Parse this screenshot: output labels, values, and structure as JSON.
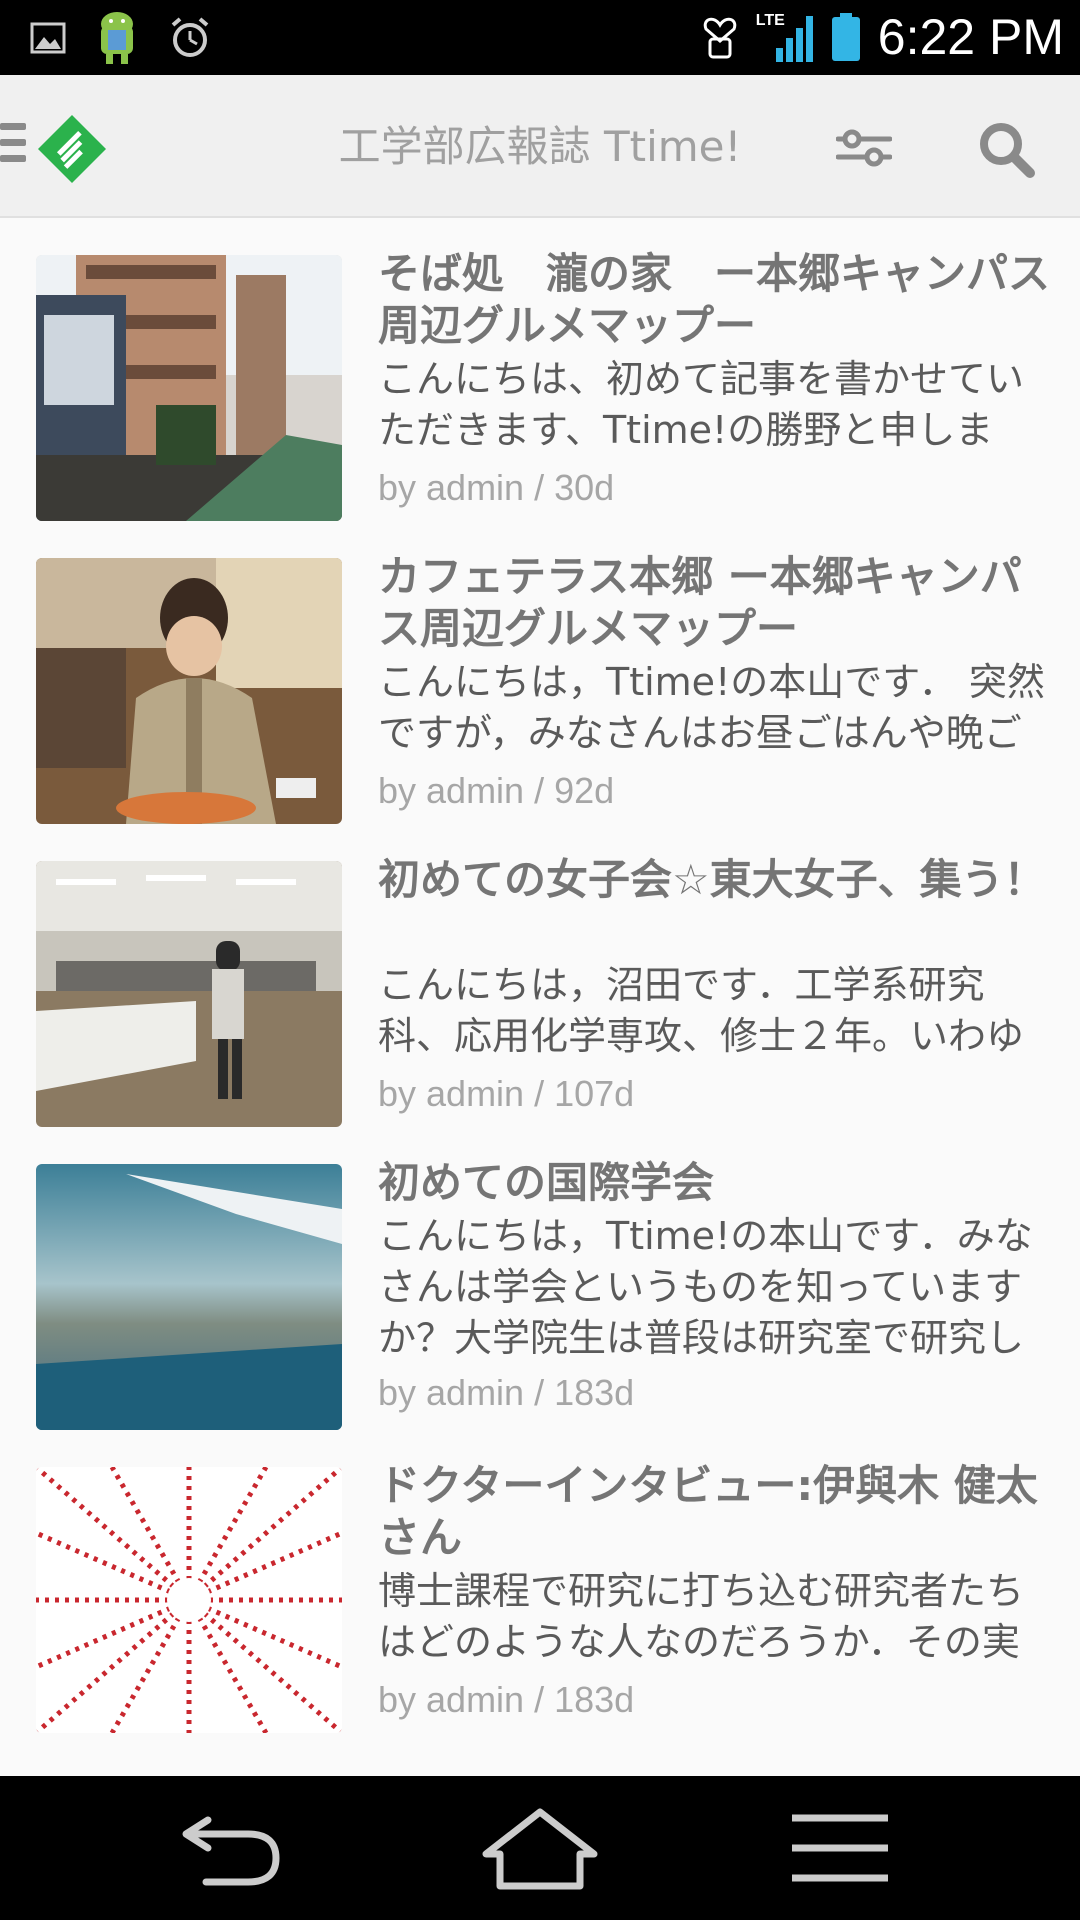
{
  "status_bar": {
    "time": "6:22 PM",
    "network": "LTE",
    "icons": [
      "picture-icon",
      "android-icon",
      "alarm-icon",
      "heart-notification-icon",
      "signal-icon",
      "battery-icon"
    ]
  },
  "app_bar": {
    "title": "工学部広報誌 Ttime!",
    "icons": [
      "menu-icon",
      "feedly-logo-icon",
      "filter-icon",
      "search-icon"
    ]
  },
  "articles": [
    {
      "title": "そば処　瀧の家　ー本郷キャンパス周辺グルメマップー",
      "summary": "こんにちは、初めて記事を書かせていただきます、Ttime!の勝野と申しま",
      "meta": "by admin / 30d"
    },
    {
      "title": "カフェテラス本郷 ー本郷キャンパス周辺グルメマップー",
      "summary": "こんにちは，Ttime!の本山です． 突然ですが，みなさんはお昼ごはんや晩ご",
      "meta": "by admin / 92d"
    },
    {
      "title": "初めての女子会☆東大女子、集う！",
      "summary": "こんにちは，沼田です．工学系研究科、応用化学専攻、修士２年。いわゆ",
      "meta": "by admin / 107d"
    },
    {
      "title": "初めての国際学会",
      "summary": "こんにちは，Ttime!の本山です．みなさんは学会というものを知っていますか？大学院生は普段は研究室で研究し",
      "meta": "by admin / 183d"
    },
    {
      "title": "ドクターインタビュー:伊與木 健太さん",
      "summary": "博士課程で研究に打ち込む研究者たちはどのような人なのだろうか．その実",
      "meta": "by admin / 183d"
    }
  ],
  "nav_bar": {
    "buttons": [
      "back-icon",
      "home-icon",
      "recent-apps-icon"
    ]
  }
}
